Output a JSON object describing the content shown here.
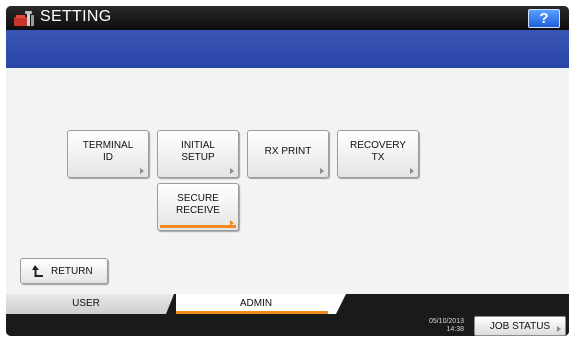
{
  "header": {
    "title": "SETTING",
    "help_label": "?",
    "icon": "toolbox-settings-icon"
  },
  "menu": {
    "terminal_id": "TERMINAL\nID",
    "initial_setup": "INITIAL\nSETUP",
    "rx_print": "RX PRINT",
    "recovery_tx": "RECOVERY\nTX",
    "secure_receive": "SECURE\nRECEIVE"
  },
  "return_label": "RETURN",
  "tabs": {
    "user": "USER",
    "admin": "ADMIN",
    "active": "ADMIN"
  },
  "status": {
    "date": "05/10/2013",
    "time": "14:38",
    "job_status_label": "JOB STATUS"
  },
  "colors": {
    "accent_orange": "#f08a1c",
    "header_blue": "#2a46a8",
    "help_blue": "#1f5fd8"
  }
}
